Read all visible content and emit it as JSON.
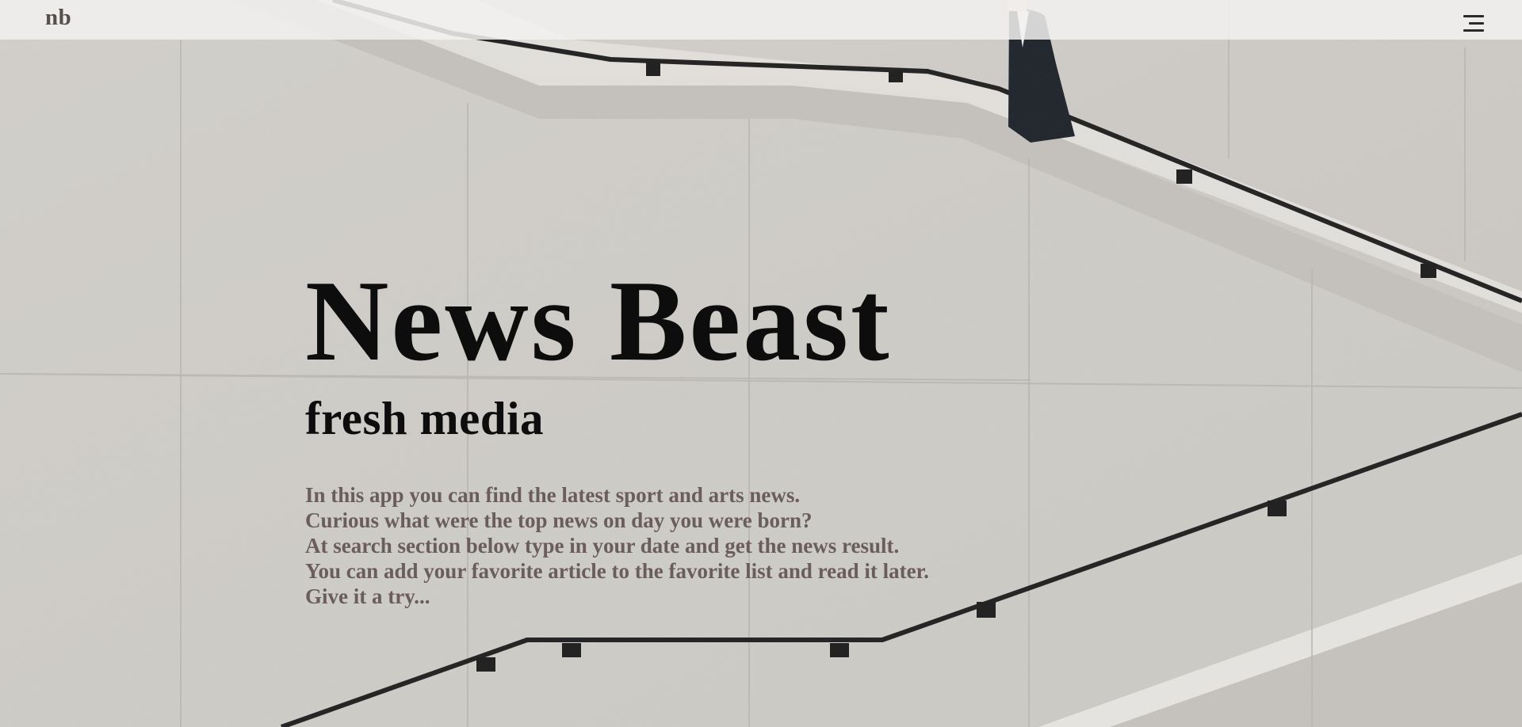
{
  "navbar": {
    "logo_text": "nb",
    "menu_icon": "hamburger-menu-icon"
  },
  "hero": {
    "title": "News Beast",
    "subtitle": "fresh media",
    "description_lines": [
      "In this app you can find the latest sport and arts news.",
      "Curious what were the top news on day you were born?",
      "At search section below type in your date and get the news result.",
      "You can add your favorite article to the favorite list and read it later.",
      "Give it a try..."
    ]
  },
  "colors": {
    "navbar_bg": "#f2f1f0",
    "logo": "#55504d",
    "title": "#0d0d0d",
    "description": "#6a5d5c",
    "background": "#cfccc8"
  }
}
